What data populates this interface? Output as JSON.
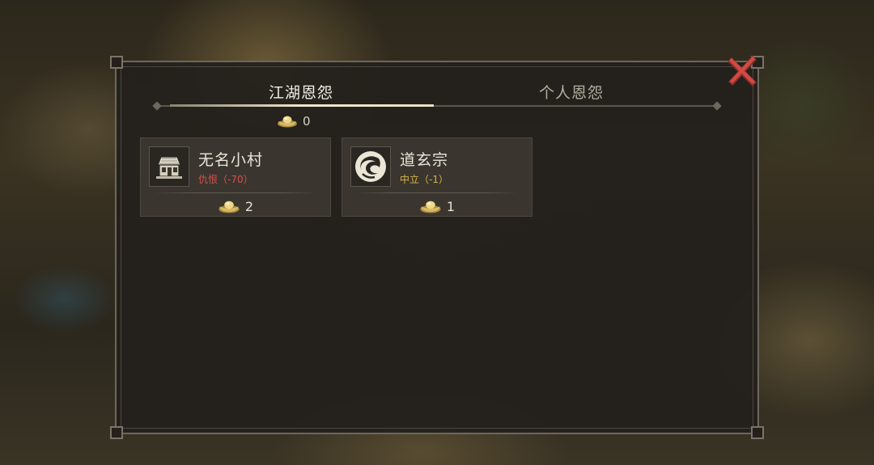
{
  "tabs": [
    {
      "label": "江湖恩怨",
      "active": true
    },
    {
      "label": "个人恩怨",
      "active": false
    }
  ],
  "total": {
    "icon": "gold-ingot-icon",
    "value": "0"
  },
  "factions": [
    {
      "name": "无名小村",
      "icon": "village-house-icon",
      "status": "仇恨（-70）",
      "status_color": "#d9504a",
      "reward_icon": "gold-ingot-icon",
      "reward": "2"
    },
    {
      "name": "道玄宗",
      "icon": "sect-crane-emblem-icon",
      "status": "中立（-1）",
      "status_color": "#d8b24a",
      "reward_icon": "gold-ingot-icon",
      "reward": "1"
    }
  ],
  "close": {
    "icon": "close-icon",
    "color": "#d24a44"
  }
}
